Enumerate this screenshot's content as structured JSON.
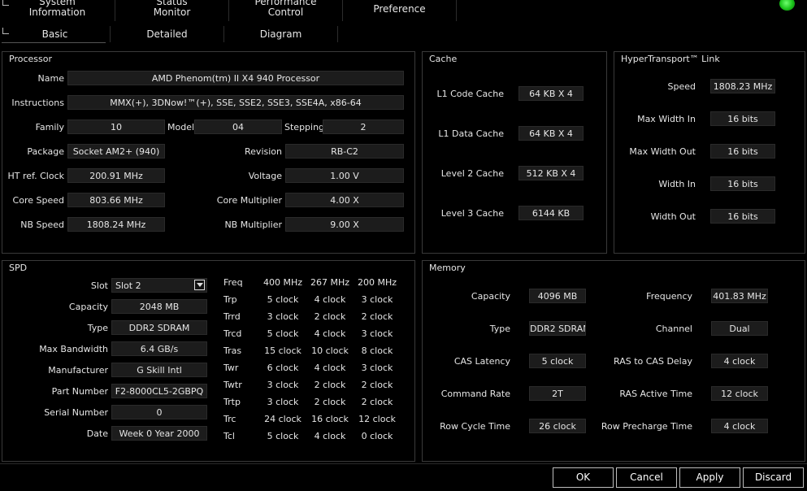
{
  "tabs": {
    "system": [
      "System",
      "Information"
    ],
    "status": [
      "Status",
      "Monitor"
    ],
    "performance": [
      "Performance",
      "Control"
    ],
    "preference": "Preference"
  },
  "subtabs": {
    "basic": "Basic",
    "detailed": "Detailed",
    "diagram": "Diagram"
  },
  "processor": {
    "title": "Processor",
    "name_label": "Name",
    "name": "AMD Phenom(tm) II X4 940 Processor",
    "instructions_label": "Instructions",
    "instructions": "MMX(+), 3DNow!™(+), SSE, SSE2, SSE3, SSE4A, x86-64",
    "family_label": "Family",
    "family": "10",
    "model_label": "Model",
    "model": "04",
    "stepping_label": "Stepping",
    "stepping": "2",
    "package_label": "Package",
    "package": "Socket AM2+ (940)",
    "revision_label": "Revision",
    "revision": "RB-C2",
    "ht_ref_label": "HT ref. Clock",
    "ht_ref": "200.91 MHz",
    "voltage_label": "Voltage",
    "voltage": "1.00 V",
    "core_speed_label": "Core Speed",
    "core_speed": "803.66 MHz",
    "core_mult_label": "Core Multiplier",
    "core_mult": "4.00 X",
    "nb_speed_label": "NB Speed",
    "nb_speed": "1808.24 MHz",
    "nb_mult_label": "NB Multiplier",
    "nb_mult": "9.00 X"
  },
  "cache": {
    "title": "Cache",
    "l1_code_label": "L1 Code Cache",
    "l1_code": "64 KB X 4",
    "l1_data_label": "L1 Data Cache",
    "l1_data": "64 KB X 4",
    "l2_label": "Level 2 Cache",
    "l2": "512 KB X 4",
    "l3_label": "Level 3 Cache",
    "l3": "6144 KB"
  },
  "ht": {
    "title": "HyperTransport™ Link",
    "speed_label": "Speed",
    "speed": "1808.23 MHz",
    "max_in_label": "Max Width In",
    "max_in": "16 bits",
    "max_out_label": "Max Width Out",
    "max_out": "16 bits",
    "in_label": "Width In",
    "in": "16 bits",
    "out_label": "Width Out",
    "out": "16 bits"
  },
  "spd": {
    "title": "SPD",
    "slot_label": "Slot",
    "slot": "Slot 2",
    "capacity_label": "Capacity",
    "capacity": "2048 MB",
    "type_label": "Type",
    "type": "DDR2 SDRAM",
    "bandwidth_label": "Max Bandwidth",
    "bandwidth": "6.4 GB/s",
    "manufacturer_label": "Manufacturer",
    "manufacturer": "G Skill Intl",
    "part_label": "Part Number",
    "part": "F2-8000CL5-2GBPQ",
    "serial_label": "Serial Number",
    "serial": "0",
    "date_label": "Date",
    "date": "Week 0 Year 2000",
    "timings": [
      [
        "Freq",
        "400 MHz",
        "267 MHz",
        "200 MHz"
      ],
      [
        "Trp",
        "5 clock",
        "4 clock",
        "3 clock"
      ],
      [
        "Trrd",
        "3 clock",
        "2 clock",
        "2 clock"
      ],
      [
        "Trcd",
        "5 clock",
        "4 clock",
        "3 clock"
      ],
      [
        "Tras",
        "15 clock",
        "10 clock",
        "8 clock"
      ],
      [
        "Twr",
        "6 clock",
        "4 clock",
        "3 clock"
      ],
      [
        "Twtr",
        "3 clock",
        "2 clock",
        "2 clock"
      ],
      [
        "Trtp",
        "3 clock",
        "2 clock",
        "2 clock"
      ],
      [
        "Trc",
        "24 clock",
        "16 clock",
        "12 clock"
      ],
      [
        "Tcl",
        "5 clock",
        "4 clock",
        "0 clock"
      ]
    ]
  },
  "memory": {
    "title": "Memory",
    "capacity_label": "Capacity",
    "capacity": "4096 MB",
    "frequency_label": "Frequency",
    "frequency": "401.83 MHz",
    "type_label": "Type",
    "type": "DDR2 SDRAM",
    "channel_label": "Channel",
    "channel": "Dual",
    "cas_label": "CAS Latency",
    "cas": "5 clock",
    "ras_cas_label": "RAS to CAS Delay",
    "ras_cas": "4 clock",
    "cmd_rate_label": "Command Rate",
    "cmd_rate": "2T",
    "ras_active_label": "RAS Active Time",
    "ras_active": "12 clock",
    "row_cycle_label": "Row Cycle Time",
    "row_cycle": "26 clock",
    "row_precharge_label": "Row Precharge Time",
    "row_precharge": "4 clock"
  },
  "buttons": {
    "ok": "OK",
    "cancel": "Cancel",
    "apply": "Apply",
    "discard": "Discard"
  },
  "colors": {
    "led": "#19c219",
    "field_bg": "#1c1c1c",
    "border": "#3a3a3a"
  }
}
